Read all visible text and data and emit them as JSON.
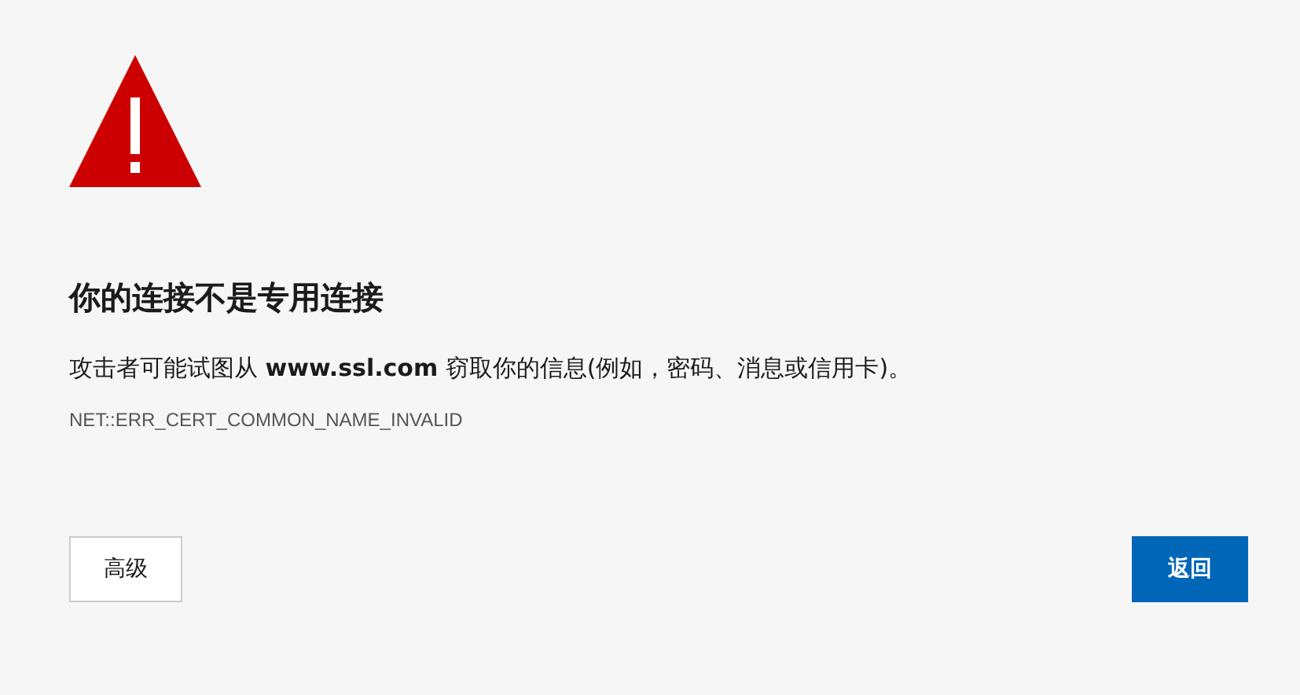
{
  "heading": "你的连接不是专用连接",
  "message": "攻击者可能试图从 **www.ssl.com** 窃取你的信息(例如，密码、消息或信用卡)。",
  "error_code": "NET::ERR_CERT_COMMON_NAME_INVALID",
  "buttons": [
    {
      "label": "高级",
      "kind": "secondary"
    },
    {
      "label": "返回",
      "kind": "primary"
    }
  ]
}
